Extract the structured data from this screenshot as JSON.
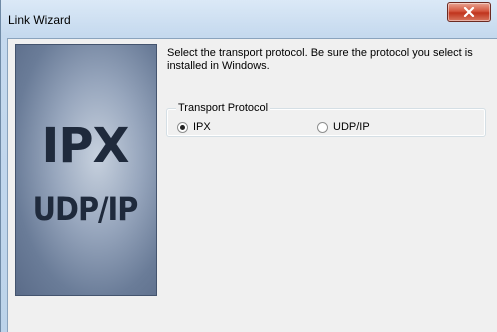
{
  "window": {
    "title": "Link Wizard"
  },
  "banner": {
    "line1": "IPX",
    "line2": "UDP/IP"
  },
  "instructions": "Select the transport protocol. Be sure the protocol you select is installed in Windows.",
  "transport_group": {
    "label": "Transport Protocol",
    "options": [
      {
        "label": "IPX",
        "selected": true
      },
      {
        "label": "UDP/IP",
        "selected": false
      }
    ]
  }
}
